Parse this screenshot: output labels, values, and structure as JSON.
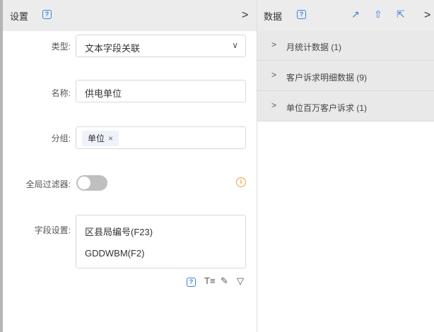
{
  "settings": {
    "title": "设置",
    "help_glyph": "?",
    "collapse_glyph": ">",
    "type": {
      "label": "类型:",
      "value": "文本字段关联",
      "arrow": "∨"
    },
    "name": {
      "label": "名称:",
      "value": "供电单位"
    },
    "group": {
      "label": "分组:",
      "tag": "单位",
      "tag_close": "×"
    },
    "global_filter": {
      "label": "全局过滤器:",
      "enabled": false,
      "info_glyph": "i"
    },
    "field_settings": {
      "label": "字段设置:",
      "fields": [
        "区县局编号(F23)",
        "GDDWBM(F2)"
      ]
    },
    "tools": {
      "help": "?",
      "text": "T≡",
      "edit": "✎",
      "filter": "▽"
    }
  },
  "data_panel": {
    "title": "数据",
    "help_glyph": "?",
    "icons": {
      "chart": "↗",
      "upload": "⇧",
      "export": "⇱",
      "collapse": ">"
    },
    "items": [
      {
        "chevron": ">",
        "label": "月统计数据 (1)"
      },
      {
        "chevron": ">",
        "label": "客户诉求明细数据 (9)"
      },
      {
        "chevron": ">",
        "label": "单位百万客户诉求 (1)"
      }
    ]
  },
  "colors": {
    "accent": "#3b7fe0",
    "warning": "#e6a23c",
    "header_bg": "#ececec"
  }
}
